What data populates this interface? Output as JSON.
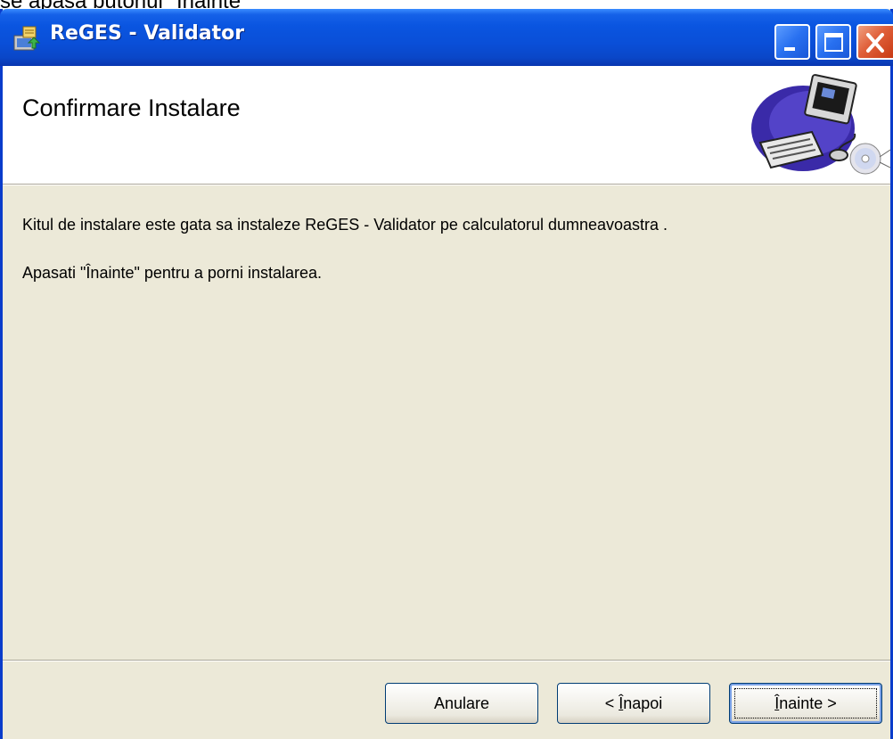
{
  "caption": "se apasa butonul \"Înainte\"",
  "window": {
    "title": "ReGES - Validator",
    "app_icon": "installer-icon",
    "controls": {
      "minimize": "minimize-icon",
      "maximize": "maximize-icon",
      "close": "close-icon"
    }
  },
  "header": {
    "title": "Confirmare Instalare",
    "art": "computer-cd-illustration"
  },
  "body": {
    "line1": "Kitul de instalare este gata sa instaleze ReGES - Validator pe calculatorul dumneavoastra  .",
    "line2": "Apasati \"Înainte\" pentru a porni instalarea."
  },
  "buttons": {
    "cancel": "Anulare",
    "back_prefix": "< ",
    "back_accel": "Î",
    "back_rest": "napoi",
    "next_accel": "Î",
    "next_rest": "nainte >"
  },
  "colors": {
    "titlebar": "#0a55e0",
    "window_bg": "#ece9d8",
    "close_button": "#e0603a"
  }
}
